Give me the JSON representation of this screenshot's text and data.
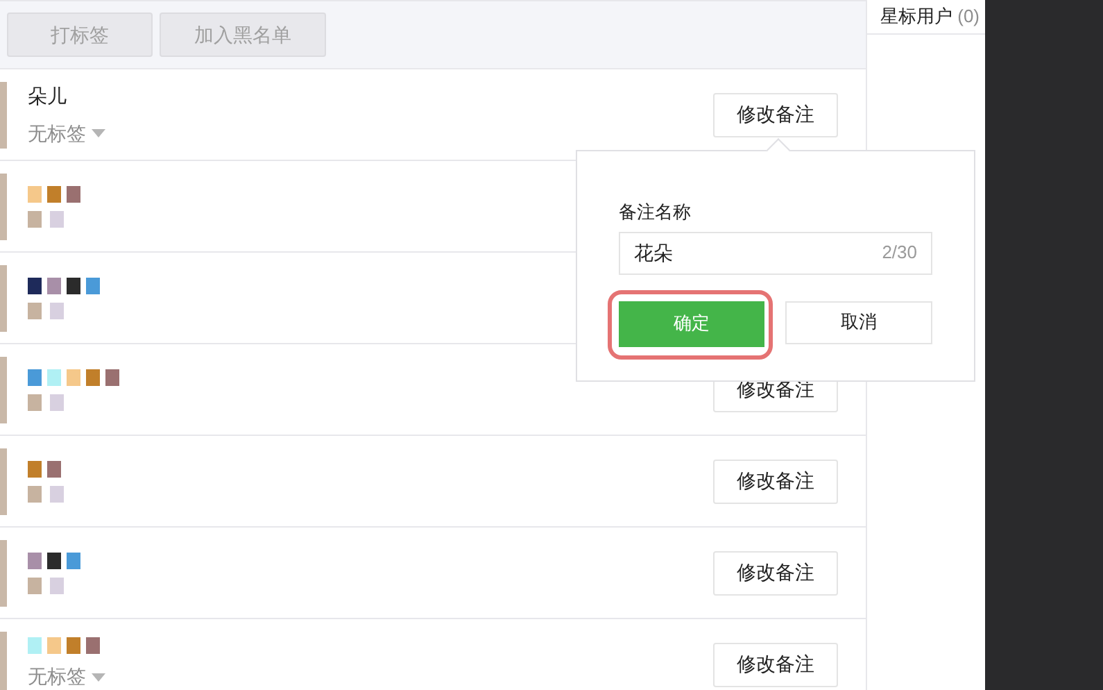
{
  "toolbar": {
    "buttons": [
      "打标签",
      "加入黑名单"
    ]
  },
  "users": [
    {
      "kind": "named",
      "name": "朵儿",
      "tag": "无标签",
      "action": "修改备注"
    },
    {
      "kind": "masked"
    },
    {
      "kind": "masked"
    },
    {
      "kind": "masked",
      "action": "修改备注"
    },
    {
      "kind": "masked",
      "action": "修改备注"
    },
    {
      "kind": "masked",
      "action": "修改备注"
    },
    {
      "kind": "masked",
      "tag": "无标签",
      "action": "修改备注"
    }
  ],
  "sidebar": {
    "starred": {
      "label": "星标用户",
      "count": "(0)"
    }
  },
  "remark_popover": {
    "label": "备注名称",
    "value": "花朵",
    "counter": "2/30",
    "confirm": "确定",
    "cancel": "取消",
    "confirm_highlighted": true
  }
}
